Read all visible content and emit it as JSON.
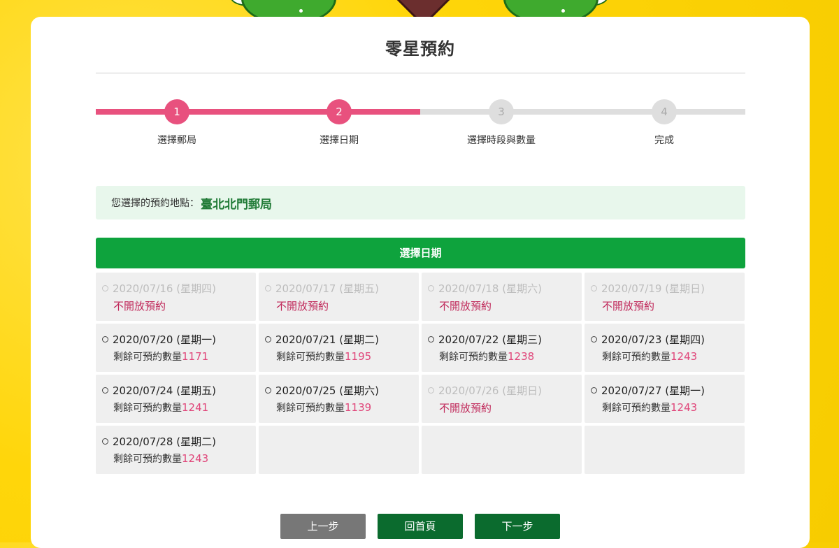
{
  "page_title": "零星預約",
  "steps": [
    {
      "number": "1",
      "label": "選擇郵局"
    },
    {
      "number": "2",
      "label": "選擇日期"
    },
    {
      "number": "3",
      "label": "選擇時段與數量"
    },
    {
      "number": "4",
      "label": "完成"
    }
  ],
  "location": {
    "prefix": "您選擇的預約地點：",
    "name": "臺北北門郵局"
  },
  "date_header": "選擇日期",
  "remaining_label": "剩餘可預約數量",
  "closed_label": "不開放預約",
  "dates": [
    {
      "date": "2020/07/16 (星期四)",
      "status": "不開放預約",
      "open": false
    },
    {
      "date": "2020/07/17 (星期五)",
      "status": "不開放預約",
      "open": false
    },
    {
      "date": "2020/07/18 (星期六)",
      "status": "不開放預約",
      "open": false
    },
    {
      "date": "2020/07/19 (星期日)",
      "status": "不開放預約",
      "open": false
    },
    {
      "date": "2020/07/20 (星期一)",
      "remaining": "1171",
      "open": true
    },
    {
      "date": "2020/07/21 (星期二)",
      "remaining": "1195",
      "open": true
    },
    {
      "date": "2020/07/22 (星期三)",
      "remaining": "1238",
      "open": true
    },
    {
      "date": "2020/07/23 (星期四)",
      "remaining": "1243",
      "open": true
    },
    {
      "date": "2020/07/24 (星期五)",
      "remaining": "1241",
      "open": true
    },
    {
      "date": "2020/07/25 (星期六)",
      "remaining": "1139",
      "open": true
    },
    {
      "date": "2020/07/26 (星期日)",
      "status": "不開放預約",
      "open": false
    },
    {
      "date": "2020/07/27 (星期一)",
      "remaining": "1243",
      "open": true
    },
    {
      "date": "2020/07/28 (星期二)",
      "remaining": "1243",
      "open": true
    }
  ],
  "buttons": {
    "prev": "上一步",
    "home": "回首頁",
    "next": "下一步"
  },
  "colors": {
    "accent_pink": "#e8517e",
    "header_green": "#0ea33d",
    "button_green": "#0b6b2e",
    "button_grey": "#777777",
    "background_yellow": "#ffd60a"
  }
}
